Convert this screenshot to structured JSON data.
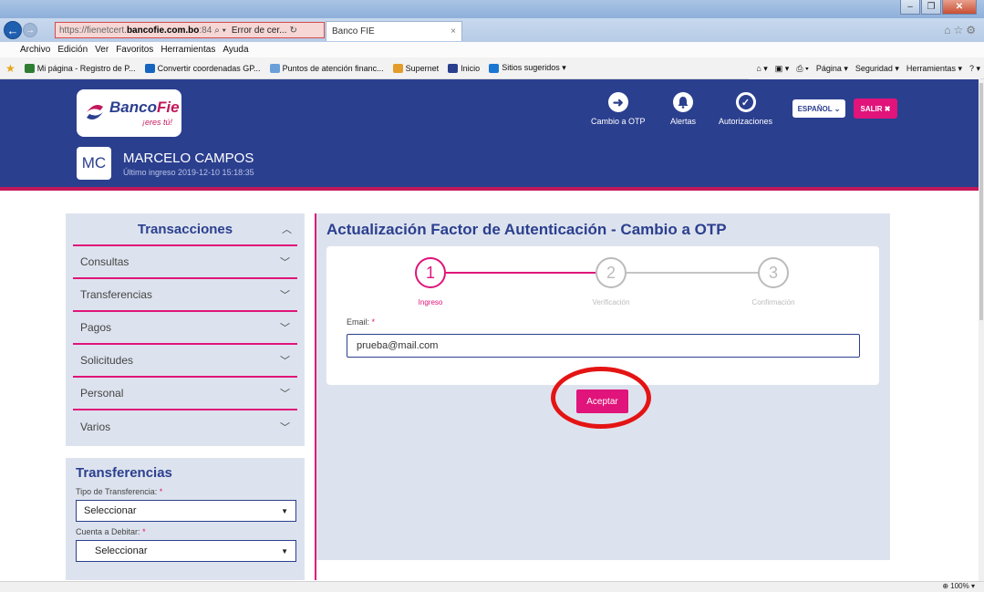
{
  "browser": {
    "address_proto": "https://",
    "address_host_pre": "fienetcert.",
    "address_domain": "bancofie.com.bo",
    "address_suffix": ":84",
    "address_error": "Error de cer...",
    "tab_title": "Banco FIE",
    "tab_close": "×",
    "menu": [
      "Archivo",
      "Edición",
      "Ver",
      "Favoritos",
      "Herramientas",
      "Ayuda"
    ],
    "favorites": [
      {
        "label": "Mi página - Registro de P...",
        "color": "#2e7d32"
      },
      {
        "label": "Convertir coordenadas GP...",
        "color": "#1565c0"
      },
      {
        "label": "Puntos de atención financ...",
        "color": "#6a9fd8"
      },
      {
        "label": "Supernet",
        "color": "#e39c2a"
      },
      {
        "label": "Inicio",
        "color": "#2b3f8f"
      },
      {
        "label": "Sitios sugeridos ▾",
        "color": "#1976d2"
      }
    ],
    "command_bar": [
      "Página ▾",
      "Seguridad ▾",
      "Herramientas ▾"
    ],
    "zoom": "100%"
  },
  "header": {
    "logo_brand_a": "Banco",
    "logo_brand_b": "Fie",
    "logo_tagline": "¡eres tú!",
    "actions": {
      "otp": "Cambio a OTP",
      "alerts": "Alertas",
      "auth": "Autorizaciones"
    },
    "language": "ESPAÑOL ⌄",
    "exit": "SALIR ✖",
    "user_initials": "MC",
    "user_name": "MARCELO CAMPOS",
    "last_login": "Último ingreso 2019-12-10 15:18:35"
  },
  "sidebar": {
    "title": "Transacciones",
    "items": [
      "Consultas",
      "Transferencias",
      "Pagos",
      "Solicitudes",
      "Personal",
      "Varios"
    ]
  },
  "transfer_form": {
    "title": "Transferencias",
    "type_label": "Tipo de Transferencia:",
    "type_value": "Seleccionar",
    "account_label": "Cuenta a Debitar:",
    "account_value": "Seleccionar",
    "required_mark": "*"
  },
  "main": {
    "title": "Actualización Factor de Autenticación - Cambio a OTP",
    "steps": [
      {
        "num": "1",
        "label": "Ingreso"
      },
      {
        "num": "2",
        "label": "Verificación"
      },
      {
        "num": "3",
        "label": "Confirmación"
      }
    ],
    "email_label": "Email:",
    "email_required": "*",
    "email_value": "prueba@mail.com",
    "accept_label": "Aceptar"
  },
  "colors": {
    "brand_blue": "#2b3f8f",
    "brand_pink": "#e0147a",
    "highlight_red": "#e41414"
  }
}
